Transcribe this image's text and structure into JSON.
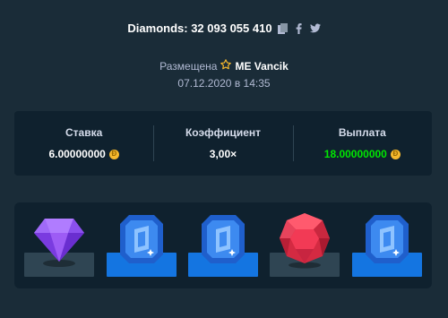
{
  "header": {
    "title": "Diamonds: 32 093 055 410"
  },
  "placement": {
    "prefix": "Размещена",
    "user": "ME Vancik",
    "date": "07.12.2020 в 14:35"
  },
  "stats": {
    "bet_label": "Ставка",
    "bet_value": "6.00000000",
    "multiplier_label": "Коэффициент",
    "multiplier_value": "3,00×",
    "payout_label": "Выплата",
    "payout_value": "18.00000000"
  },
  "gems": [
    {
      "name": "purple-diamond",
      "color": "#9d5cf5",
      "base": "grey"
    },
    {
      "name": "blue-sapphire",
      "color": "#1f6fe0",
      "base": "blue"
    },
    {
      "name": "blue-sapphire",
      "color": "#1f6fe0",
      "base": "blue"
    },
    {
      "name": "red-ruby",
      "color": "#e5304a",
      "base": "grey"
    },
    {
      "name": "blue-sapphire",
      "color": "#1f6fe0",
      "base": "blue"
    }
  ],
  "colors": {
    "background": "#1a2c38",
    "panel": "#0f212e",
    "payout_green": "#00e701",
    "highlight_base": "#1475e1",
    "default_base": "#2f4553"
  }
}
